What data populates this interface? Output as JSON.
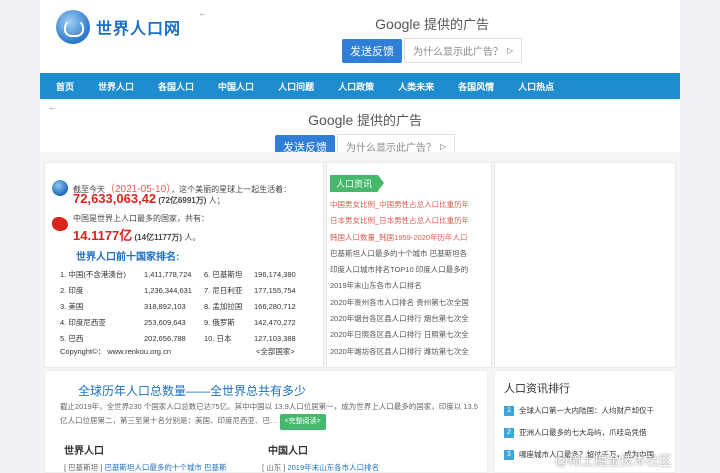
{
  "header": {
    "site_name": "世界人口网"
  },
  "ad_top": {
    "google": "Google",
    "title": "提供的广告",
    "feedback": "发送反馈",
    "why": "为什么显示此广告？",
    "back": "←"
  },
  "nav": {
    "items": [
      "首页",
      "世界人口",
      "各国人口",
      "中国人口",
      "人口问题",
      "人口政策",
      "人类未来",
      "各国风情",
      "人口热点"
    ]
  },
  "ad_mid": {
    "google": "Google",
    "title": "提供的广告",
    "feedback": "发送反馈",
    "why": "为什么显示此广告？",
    "back": "←"
  },
  "stats": {
    "line1_prefix": "截至今天",
    "date": "（2021-05-10）",
    "line1_suffix": "，这个美丽的星球上一起生活着：",
    "world_pop": "72,633,063,42",
    "world_pop_cn": "(72亿6991万)",
    "world_unit": "人；",
    "line2": "中国是世界上人口最多的国家，共有：",
    "china_pop": "14.1177亿",
    "china_pop_cn": "(14亿1177万)",
    "china_unit": "人。"
  },
  "top10": {
    "title": "世界人口前十国家排名:",
    "rows": [
      {
        "a": "1. 中国(不含港澳台)",
        "av": "1,411,778,724",
        "b": "6. 巴基斯坦",
        "bv": "196,174,380"
      },
      {
        "a": "2. 印度",
        "av": "1,236,344,631",
        "b": "7. 尼日利亚",
        "bv": "177,155,754"
      },
      {
        "a": "3. 美国",
        "av": "318,892,103",
        "b": "8. 孟加拉国",
        "bv": "166,280,712"
      },
      {
        "a": "4. 印度尼西亚",
        "av": "253,609,643",
        "b": "9. 俄罗斯",
        "bv": "142,470,272"
      },
      {
        "a": "5. 巴西",
        "av": "202,656,788",
        "b": "10. 日本",
        "bv": "127,103,388"
      }
    ],
    "copyright": "Copyright©： www.renkou.org.cn",
    "all_countries": "<全部国家>"
  },
  "news": {
    "tag": "人口资讯",
    "items": [
      {
        "text": "中国男女比例_中国男性占总人口比重历年",
        "red": true
      },
      {
        "text": "日本男女比例_日本男性占总人口比重历年",
        "red": true
      },
      {
        "text": "韩国人口数量_韩国1959-2020年历年人口",
        "red": true
      },
      {
        "text": "巴基斯坦人口最多的十个城市 巴基斯坦各",
        "red": false
      },
      {
        "text": "印度人口城市排名TOP10 印度人口最多的",
        "red": false
      },
      {
        "text": "2019年末山东各市人口排名",
        "red": false
      },
      {
        "text": "2020年贵州各市人口排名 贵州第七次全国",
        "red": false
      },
      {
        "text": "2020年烟台各区县人口排行 烟台第七次全",
        "red": false
      },
      {
        "text": "2020年日照各区县人口排行 日照第七次全",
        "red": false
      },
      {
        "text": "2020年潍坊各区县人口排行 潍坊第七次全",
        "red": false
      }
    ]
  },
  "bottom": {
    "title": "全球历年人口总数量——全世界总共有多少",
    "para": "截止2019年，全世界230 个国家人口总数已达75亿。其中中国以 13.9人口位居第一，成为世界上人口最多的国家，印度以 13.5亿人口位居第二，第三至第十名分别是：美国、印度尼西亚、巴…",
    "more": "<完整阅读>",
    "world_title": "世界人口",
    "world_item_tag": "[ 巴基斯坦 ]",
    "world_item_link": "巴基斯坦人口最多的十个城市 巴基斯",
    "china_title": "中国人口",
    "china_item_tag": "[ 山东 ]",
    "china_item_link": "2019年末山东各市人口排名"
  },
  "ranking": {
    "title": "人口资讯排行",
    "items": [
      {
        "n": "1",
        "text": "全球人口第一大内陆国：人均财产却仅千"
      },
      {
        "n": "2",
        "text": "亚洲人口最多的七大岛屿，爪哇岛凭借"
      },
      {
        "n": "3",
        "text": "哪座城市人口最多？超过千万，成为中国"
      }
    ]
  },
  "watermark": "@稀土掘金技术社区"
}
